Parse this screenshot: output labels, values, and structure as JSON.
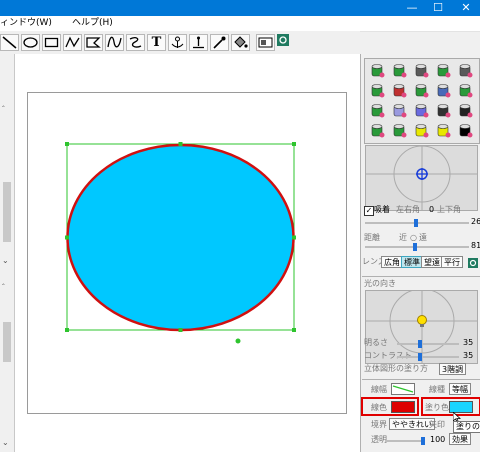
{
  "titlebar": {
    "minimize": "—",
    "maximize": "☐",
    "close": "✕"
  },
  "menu": {
    "window": "ィンドウ(W)",
    "help": "ヘルプ(H)"
  },
  "toolbar": {
    "text_tool": "T"
  },
  "material_colors": [
    "#2a9a3a",
    "#2a9a3a",
    "#5a5a5a",
    "#2a9a3a",
    "#5a5a5a",
    "#2a9a3a",
    "#c03030",
    "#2a9a3a",
    "#4a6ab8",
    "#2a9a3a",
    "#2a9a3a",
    "#9a9adf",
    "#6a6adf",
    "#333333",
    "#222222",
    "#2a9a3a",
    "#2a9a3a",
    "#e8e800",
    "#e8e800",
    "#000000"
  ],
  "view_panel": {
    "adsorb_label": "吸着",
    "lr_label": "左右角",
    "lr_value": "0",
    "ud_label": "上下角",
    "ud_value": "26",
    "distance_label": "距離",
    "near_label": "近",
    "far_label": "遠",
    "distance_value": "81",
    "lens_label": "レンズ",
    "lens_wide": "広角",
    "lens_standard": "標準",
    "lens_tele": "望遠",
    "lens_parallel": "平行"
  },
  "light_panel": {
    "title": "光の向き",
    "brightness_label": "明るさ",
    "brightness_value": "35",
    "contrast_label": "コントラスト",
    "contrast_value": "35",
    "shading_label": "立体図形の塗り方",
    "shading_value": "3階調"
  },
  "props_panel": {
    "line_width_label": "線幅",
    "line_type_label": "線種",
    "line_type_value": "等幅",
    "line_color_label": "線色",
    "line_color": "#dd0000",
    "fill_color_label": "塗り色",
    "fill_color": "#19d4ff",
    "border_label": "境界",
    "border_value": "ややきれい",
    "arrow_label": "矢印",
    "transparency_label": "透明",
    "transparency_value": "100",
    "effect_button": "効果",
    "tooltip": "塗りの色"
  },
  "shape": {
    "fill": "#00c8ff",
    "stroke": "#d01010",
    "selection": "#2ec42e"
  }
}
